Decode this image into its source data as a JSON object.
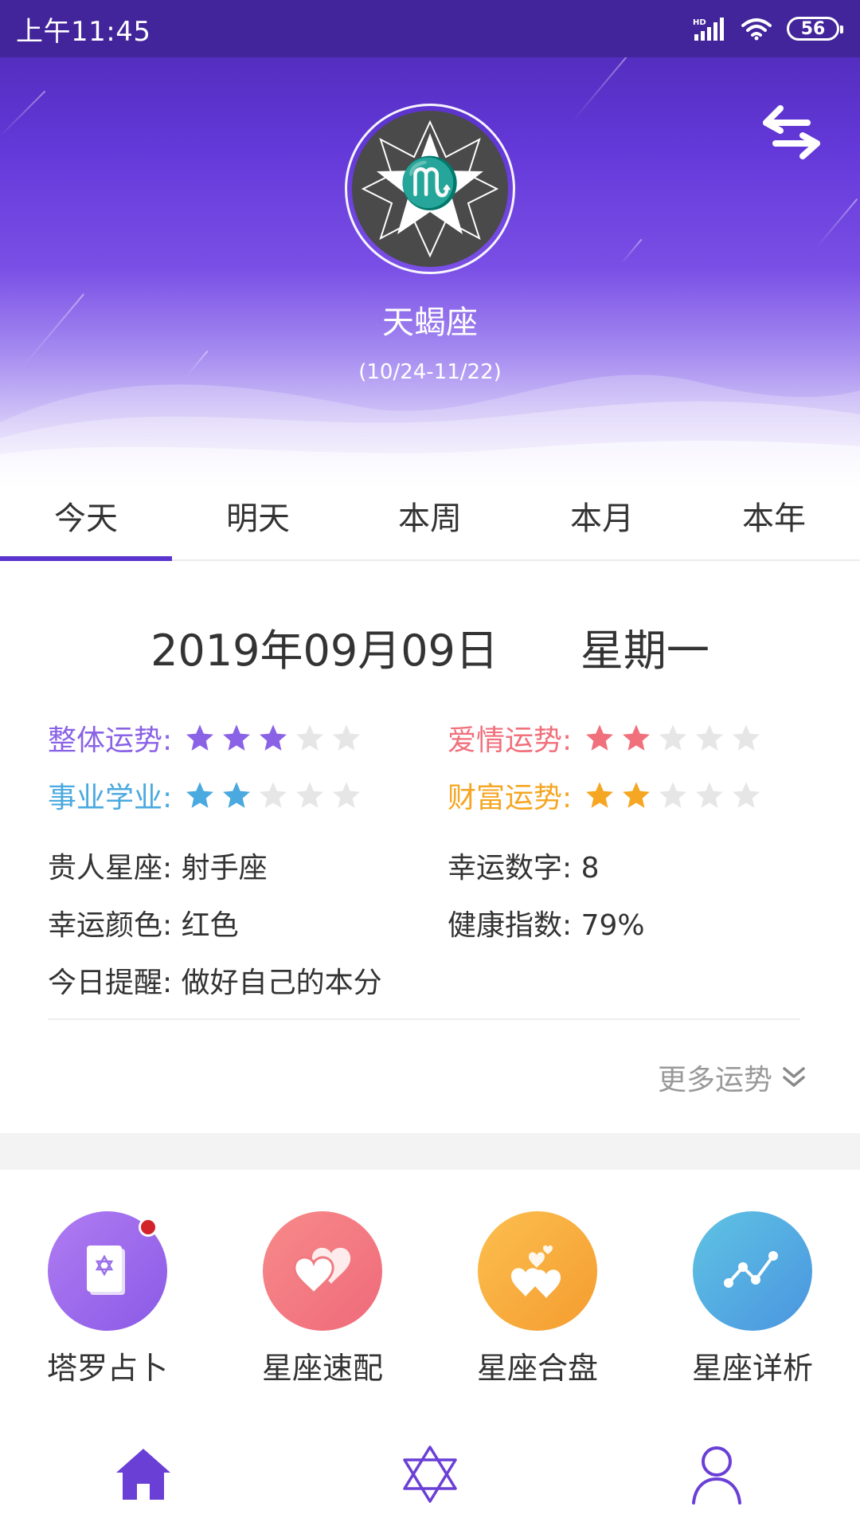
{
  "status_bar": {
    "time": "上午11:45",
    "battery": "56",
    "icons": [
      "hd-signal-icon",
      "wifi-icon",
      "battery-icon"
    ]
  },
  "header": {
    "sign_name": "天蝎座",
    "date_range": "(10/24-11/22)",
    "sign_icon": "scorpio-icon",
    "swap_icon": "swap-arrows-icon"
  },
  "tabs": [
    {
      "label": "今天",
      "active": true
    },
    {
      "label": "明天",
      "active": false
    },
    {
      "label": "本周",
      "active": false
    },
    {
      "label": "本月",
      "active": false
    },
    {
      "label": "本年",
      "active": false
    }
  ],
  "fortune": {
    "date": "2019年09月09日",
    "weekday": "星期一",
    "ratings": [
      {
        "label": "整体运势:",
        "stars": 3,
        "max": 5,
        "color": "#8a62e6"
      },
      {
        "label": "爱情运势:",
        "stars": 2,
        "max": 5,
        "color": "#f0707c"
      },
      {
        "label": "事业学业:",
        "stars": 2,
        "max": 5,
        "color": "#4aa9df"
      },
      {
        "label": "财富运势:",
        "stars": 2,
        "max": 5,
        "color": "#f5a623"
      }
    ],
    "details": [
      {
        "label": "贵人星座:",
        "value": "射手座"
      },
      {
        "label": "幸运数字:",
        "value": "8"
      },
      {
        "label": "幸运颜色:",
        "value": "红色"
      },
      {
        "label": "健康指数:",
        "value": "79%"
      },
      {
        "label": "今日提醒:",
        "value": "做好自己的本分"
      }
    ],
    "more_label": "更多运势"
  },
  "features": [
    {
      "label": "塔罗占卜",
      "icon": "tarot-card-icon",
      "has_badge": true
    },
    {
      "label": "星座速配",
      "icon": "double-heart-icon",
      "has_badge": false
    },
    {
      "label": "星座合盘",
      "icon": "hearts-icon",
      "has_badge": false
    },
    {
      "label": "星座详析",
      "icon": "trend-line-icon",
      "has_badge": false
    }
  ],
  "bottom_nav": [
    {
      "icon": "home-icon",
      "active": true
    },
    {
      "icon": "hexagram-icon",
      "active": false
    },
    {
      "icon": "user-icon",
      "active": false
    }
  ],
  "colors": {
    "status_bar": "#42259a",
    "header_purple": "#6338d8",
    "accent": "#5b33cf",
    "empty_star": "#e6e6e6",
    "badge_red": "#d3232a"
  }
}
